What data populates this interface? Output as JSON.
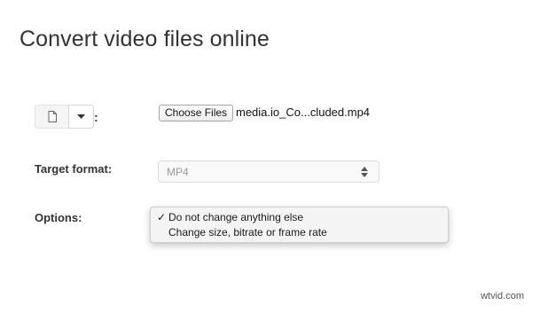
{
  "page": {
    "title": "Convert video files online"
  },
  "source": {
    "icon": "file-icon",
    "dropdown_icon": "caret-down-icon",
    "colon": ":",
    "choose_files_label": "Choose Files",
    "file_name": "media.io_Co...cluded.mp4"
  },
  "target_format": {
    "label": "Target format:",
    "selected": "MP4",
    "icon": "updown-arrows-icon"
  },
  "options": {
    "label": "Options:",
    "items": [
      {
        "label": "Do not change anything else",
        "checked": true
      },
      {
        "label": "Change size, bitrate or frame rate",
        "checked": false
      }
    ],
    "check_glyph": "✓"
  },
  "watermark": "wtvid.com"
}
